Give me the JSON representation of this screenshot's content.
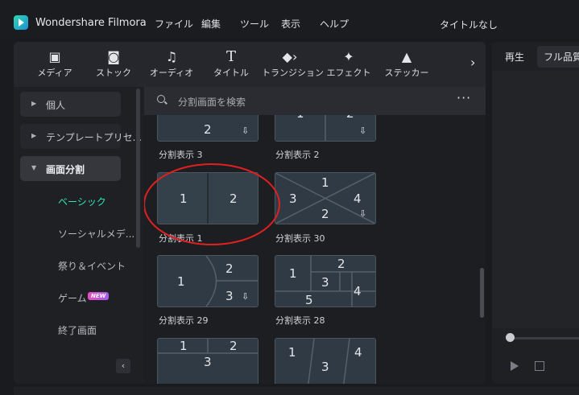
{
  "app": {
    "name": "Wondershare Filmora",
    "document_title": "タイトルなし"
  },
  "menu": [
    "ファイル",
    "編集",
    "ツール",
    "表示",
    "ヘルプ"
  ],
  "toolbar": {
    "items": [
      {
        "label": "メディア",
        "icon": "media-icon"
      },
      {
        "label": "ストック",
        "icon": "stock-icon"
      },
      {
        "label": "オーディオ",
        "icon": "audio-icon"
      },
      {
        "label": "タイトル",
        "icon": "title-icon"
      },
      {
        "label": "トランジション",
        "icon": "transition-icon"
      },
      {
        "label": "エフェクト",
        "icon": "effects-icon"
      },
      {
        "label": "ステッカー",
        "icon": "sticker-icon"
      }
    ],
    "more_glyph": "›"
  },
  "sidebar": {
    "items": [
      {
        "label": "個人",
        "expanded": false
      },
      {
        "label": "テンプレートプリセ...",
        "expanded": false
      },
      {
        "label": "画面分割",
        "expanded": true,
        "selected": true
      }
    ],
    "subitems": [
      {
        "label": "ベーシック",
        "active": true
      },
      {
        "label": "ソーシャルメデ...",
        "active": false
      },
      {
        "label": "祭り＆イベント",
        "active": false
      },
      {
        "label": "ゲーム",
        "active": false,
        "badge": "NEW"
      },
      {
        "label": "終了画面",
        "active": false
      }
    ],
    "collapse_glyph": "‹"
  },
  "search": {
    "placeholder": "分割画面を検索",
    "more_glyph": "···"
  },
  "templates": [
    {
      "label": "分割表示 3",
      "numbers": [
        "2"
      ],
      "download": true
    },
    {
      "label": "分割表示 2",
      "numbers": [
        "1",
        "2"
      ],
      "download": true
    },
    {
      "label": "分割表示 1",
      "numbers": [
        "1",
        "2"
      ],
      "download": false,
      "highlighted": true
    },
    {
      "label": "分割表示 30",
      "numbers": [
        "1",
        "3",
        "4",
        "2"
      ],
      "download": true
    },
    {
      "label": "分割表示 29",
      "numbers": [
        "1",
        "2",
        "3"
      ],
      "download": true
    },
    {
      "label": "分割表示 28",
      "numbers": [
        "2",
        "1",
        "3",
        "4",
        "5"
      ],
      "download": false
    },
    {
      "label": "",
      "numbers": [
        "1",
        "2",
        "3"
      ],
      "download": false
    },
    {
      "label": "",
      "numbers": [
        "1",
        "3",
        "4"
      ],
      "download": false
    }
  ],
  "download_glyph": "⇩",
  "preview": {
    "tabs": [
      "再生",
      "フル品質"
    ]
  },
  "colors": {
    "accent": "#2ee6b6",
    "highlight_circle": "#e02020",
    "badge": "#d94ec7"
  }
}
